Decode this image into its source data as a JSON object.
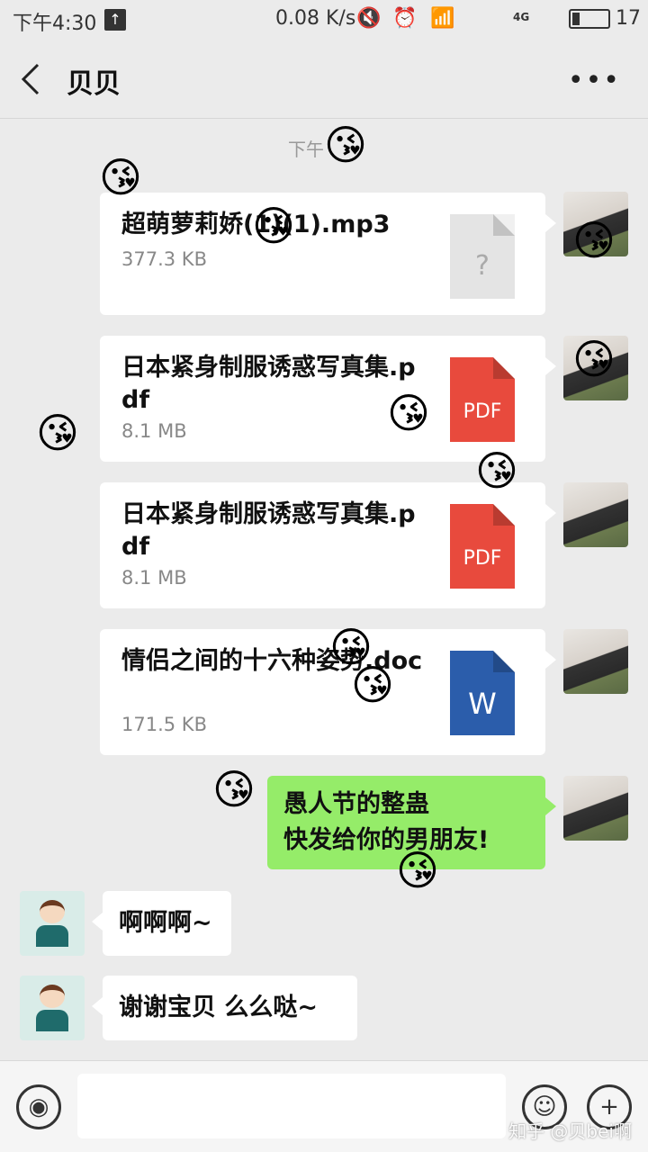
{
  "status_bar": {
    "time": "下午4:30",
    "speed": "0.08 K/s",
    "network": "4G",
    "battery": "17"
  },
  "header": {
    "back_icon": "chevron-left-icon",
    "title": "贝贝",
    "more_label": "•••"
  },
  "timestamp": "下午",
  "messages": [
    {
      "type": "file",
      "name": "超萌萝莉娇(1)(1).mp3",
      "size": "377.3 KB",
      "icon": "unknown-file-icon",
      "icon_label": "?",
      "color": "#e4e4e4"
    },
    {
      "type": "file",
      "name": "日本紧身制服诱惑写真集.pdf",
      "size": "8.1 MB",
      "icon": "pdf-file-icon",
      "icon_label": "PDF",
      "color": "#e84a3d"
    },
    {
      "type": "file",
      "name": "日本紧身制服诱惑写真集.pdf",
      "size": "8.1 MB",
      "icon": "pdf-file-icon",
      "icon_label": "PDF",
      "color": "#e84a3d"
    },
    {
      "type": "file",
      "name": "情侣之间的十六种姿势.doc",
      "size": "171.5 KB",
      "icon": "word-file-icon",
      "icon_label": "W",
      "color": "#2b5dab"
    },
    {
      "type": "text",
      "line1": "愚人节的整蛊",
      "line2": "快发给你的男朋友!"
    },
    {
      "type": "text_in",
      "text": "啊啊啊~"
    },
    {
      "type": "text_in",
      "text": "谢谢宝贝 么么哒~"
    }
  ],
  "input_bar": {
    "voice_icon": "voice-icon",
    "emoji_icon": "smiley-icon",
    "plus_icon": "plus-icon"
  },
  "watermark": "知乎 @贝bei啊",
  "overlay_emoji": "😘"
}
